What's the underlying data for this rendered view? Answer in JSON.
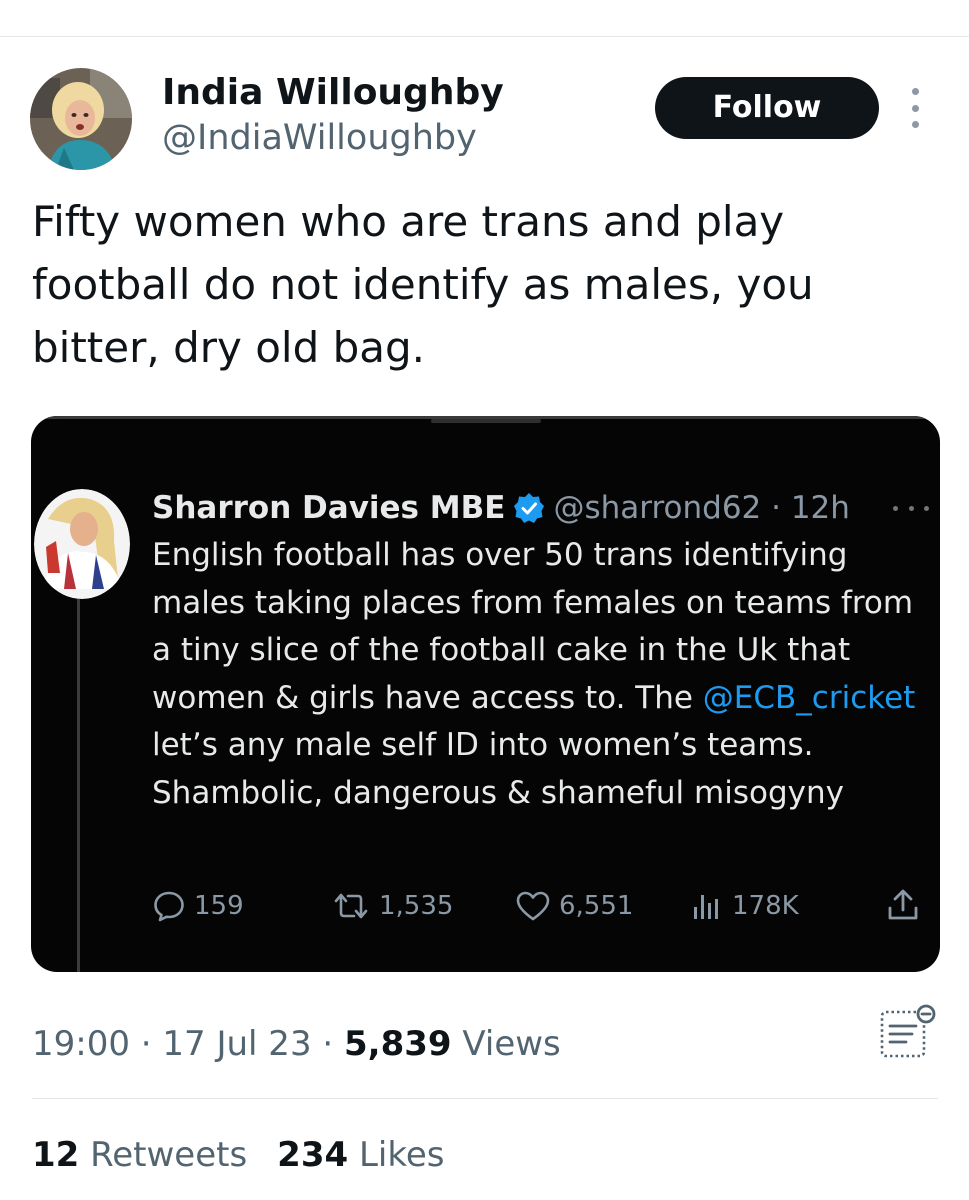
{
  "author": {
    "name": "India Willoughby",
    "handle": "@IndiaWilloughby",
    "follow_label": "Follow"
  },
  "tweet": {
    "text": "Fifty women who are trans and play\nfootball do not identify as males, you\nbitter, dry old bag."
  },
  "quote": {
    "name": "Sharron Davies MBE",
    "handle_time": "@sharrond62 · 12h",
    "text_before": "English football has over 50 trans identifying males taking places from females  on teams from a tiny slice of the football cake in the Uk that women & girls have access to. The ",
    "mention": "@ECB_cricket",
    "text_after": " let’s any male self ID into women’s teams. Shambolic, dangerous & shameful misogyny",
    "stats": {
      "replies": "159",
      "retweets": "1,535",
      "likes": "6,551",
      "views": "178K"
    }
  },
  "meta": {
    "time_date": "19:00 · 17 Jul 23 · ",
    "views_count": "5,839",
    "views_label": " Views"
  },
  "engagement": {
    "retweets_count": "12",
    "retweets_label": " Retweets",
    "likes_count": "234",
    "likes_label": " Likes"
  },
  "colors": {
    "text_primary": "#0f1419",
    "text_secondary": "#536471",
    "link_blue": "#1d9bf0",
    "card_background": "#050505"
  },
  "icons": [
    "more-icon",
    "verified-badge-icon",
    "reply-icon",
    "retweet-icon",
    "like-icon",
    "views-icon",
    "share-icon",
    "analytics-icon"
  ]
}
